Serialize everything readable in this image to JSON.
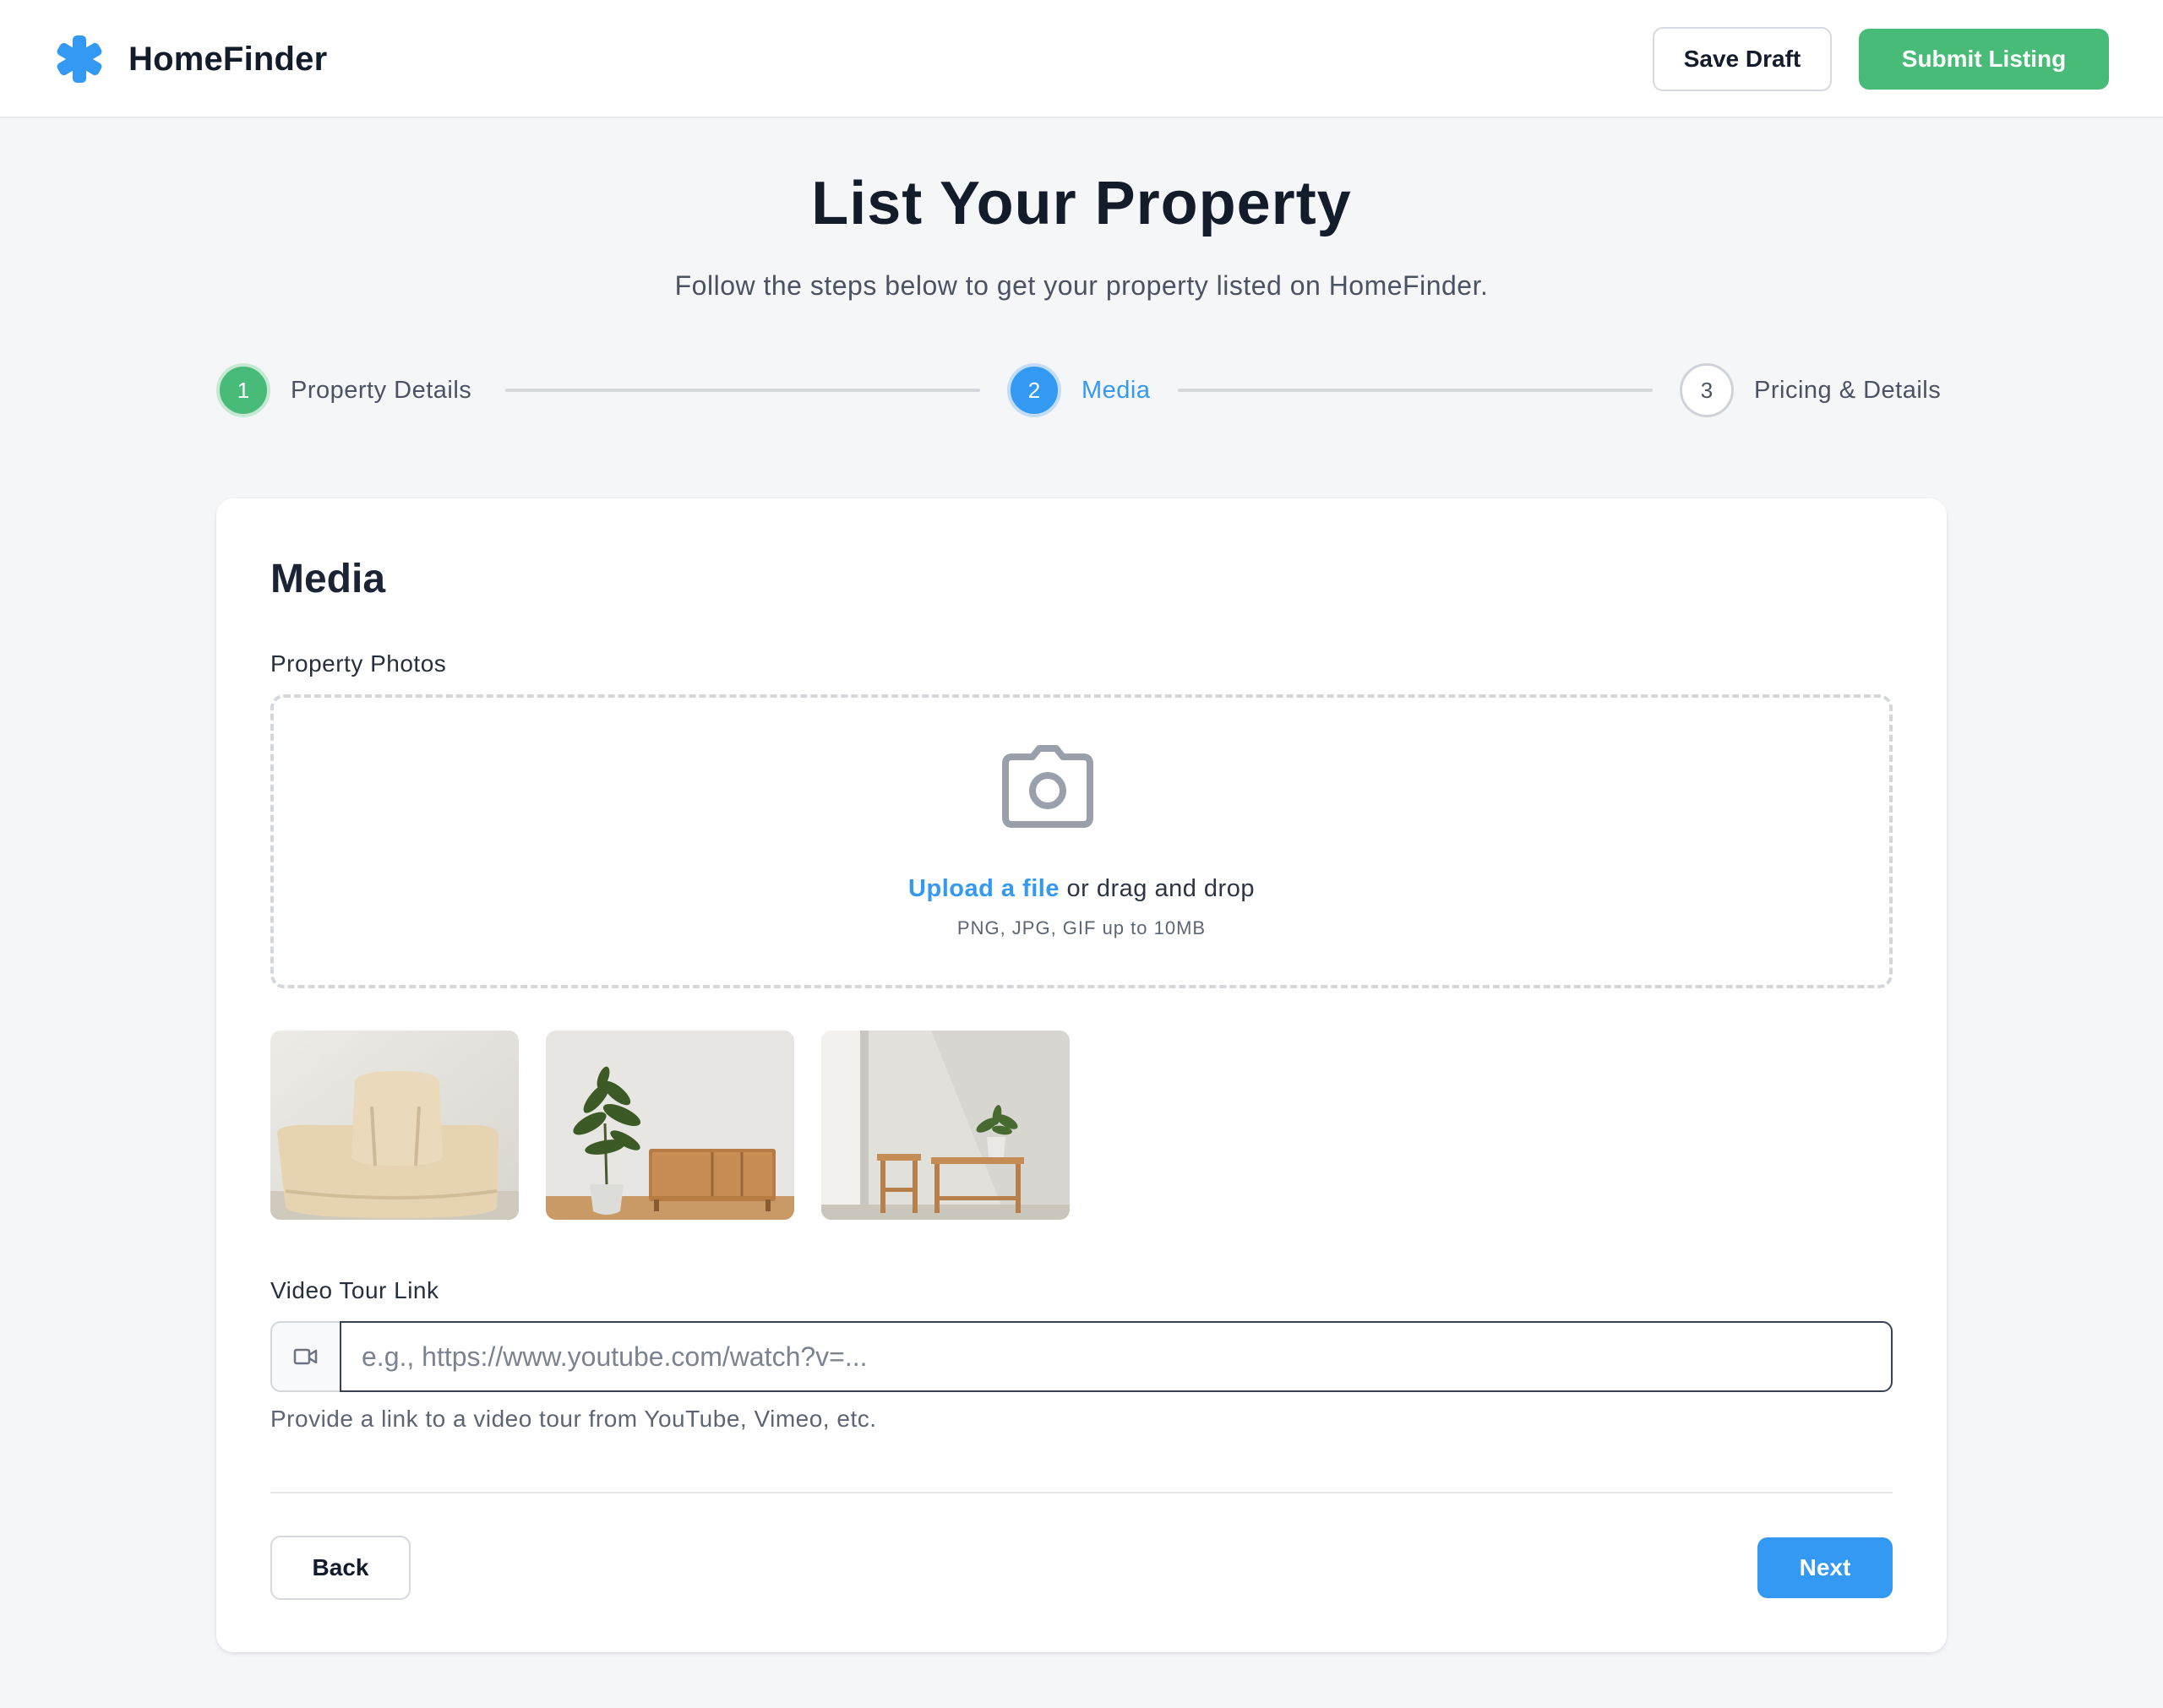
{
  "header": {
    "brand_name": "HomeFinder",
    "brand_icon": "asterisk-icon",
    "save_draft_label": "Save Draft",
    "submit_label": "Submit Listing"
  },
  "intro": {
    "title": "List Your Property",
    "subtitle": "Follow the steps below to get your property listed on HomeFinder."
  },
  "steps": [
    {
      "number": "1",
      "label": "Property Details",
      "state": "complete"
    },
    {
      "number": "2",
      "label": "Media",
      "state": "active"
    },
    {
      "number": "3",
      "label": "Pricing & Details",
      "state": "upcoming"
    }
  ],
  "media": {
    "section_title": "Media",
    "photos_label": "Property Photos",
    "upload_icon": "camera-icon",
    "upload_link": "Upload a file",
    "upload_rest": " or drag and drop",
    "upload_hint": "PNG, JPG, GIF up to 10MB",
    "thumbnails": [
      {
        "subject": "knit cushion on chair"
      },
      {
        "subject": "potted plant beside wooden sideboard"
      },
      {
        "subject": "wooden stool and bench with small plant"
      }
    ],
    "video_label": "Video Tour Link",
    "video_icon": "video-camera-icon",
    "video_value": "",
    "video_placeholder": "e.g., https://www.youtube.com/watch?v=...",
    "video_helper": "Provide a link to a video tour from YouTube, Vimeo, etc.",
    "back_label": "Back",
    "next_label": "Next"
  },
  "colors": {
    "primary": "#3399f3",
    "success": "#48bb78",
    "text_dark": "#131c2b",
    "background": "#f5f6f8"
  }
}
